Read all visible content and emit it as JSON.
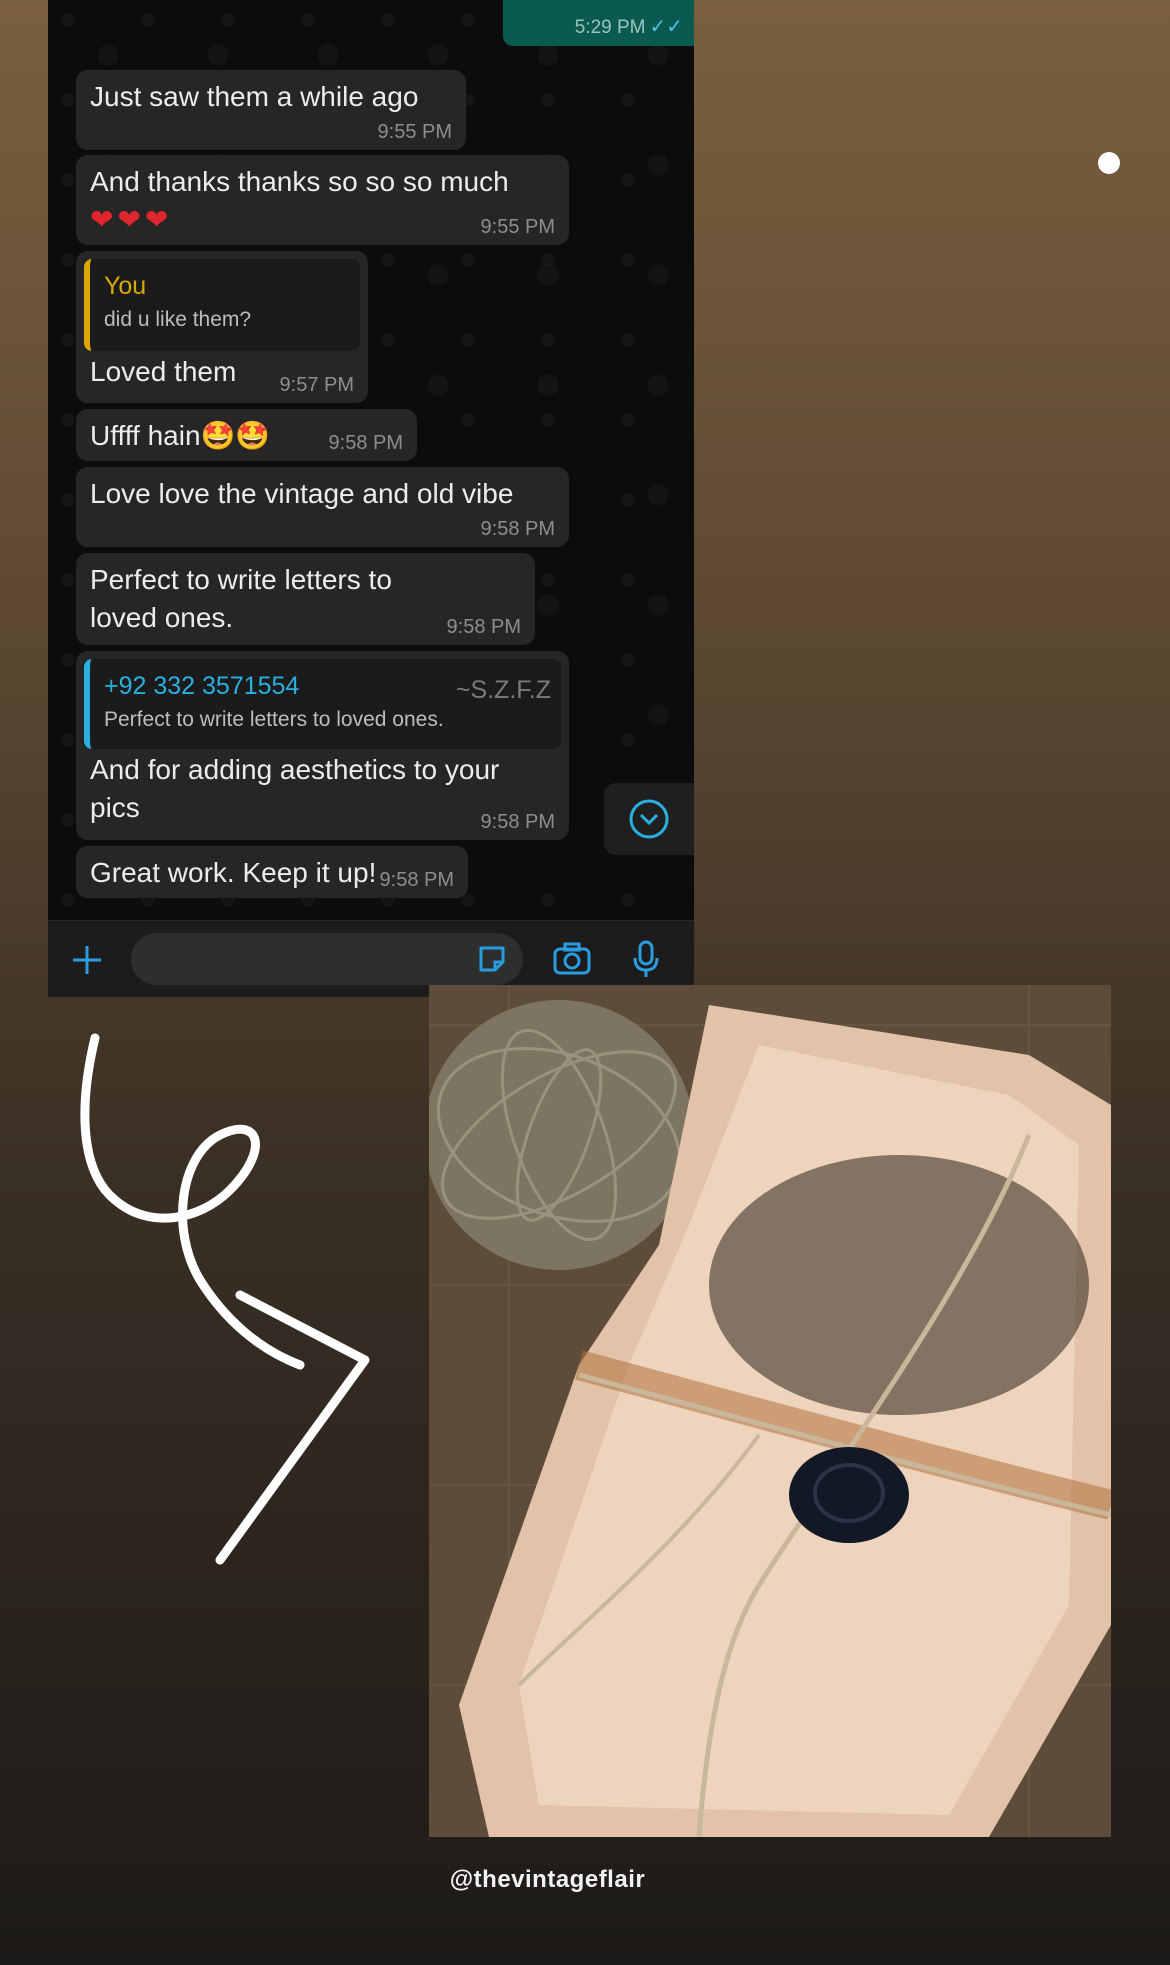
{
  "chat": {
    "outgoing_time": "5:29 PM",
    "messages": [
      {
        "text": "Just saw them a while ago",
        "time": "9:55 PM"
      },
      {
        "text": "And thanks thanks so so so much",
        "emoji": "❤❤❤",
        "time": "9:55 PM"
      },
      {
        "quote_name": "You",
        "quote_text": "did u like them?",
        "text": "Loved them",
        "time": "9:57 PM"
      },
      {
        "text": "Uffff hain🤩🤩",
        "time": "9:58 PM"
      },
      {
        "text": "Love love the vintage and old vibe",
        "time": "9:58 PM"
      },
      {
        "text": "Perfect to write letters to loved ones.",
        "time": "9:58 PM"
      },
      {
        "quote_name": "+92 332 3571554",
        "quote_alias": "~S.Z.F.Z",
        "quote_text": "Perfect to write letters to loved ones.",
        "text": "And for adding aesthetics to your pics",
        "time": "9:58 PM"
      },
      {
        "text": "Great work. Keep it up!",
        "time": "9:58 PM"
      }
    ],
    "icons": {
      "add": "plus-icon",
      "sticker": "sticker-icon",
      "camera": "camera-icon",
      "mic": "microphone-icon",
      "scroll": "chevron-down-icon"
    }
  },
  "caption": "@thevintageflair",
  "colors": {
    "bubble": "#262626",
    "outgoing": "#0b5a4f",
    "accent_blue": "#2ab0e0",
    "quote_yellow": "#d9a900"
  }
}
